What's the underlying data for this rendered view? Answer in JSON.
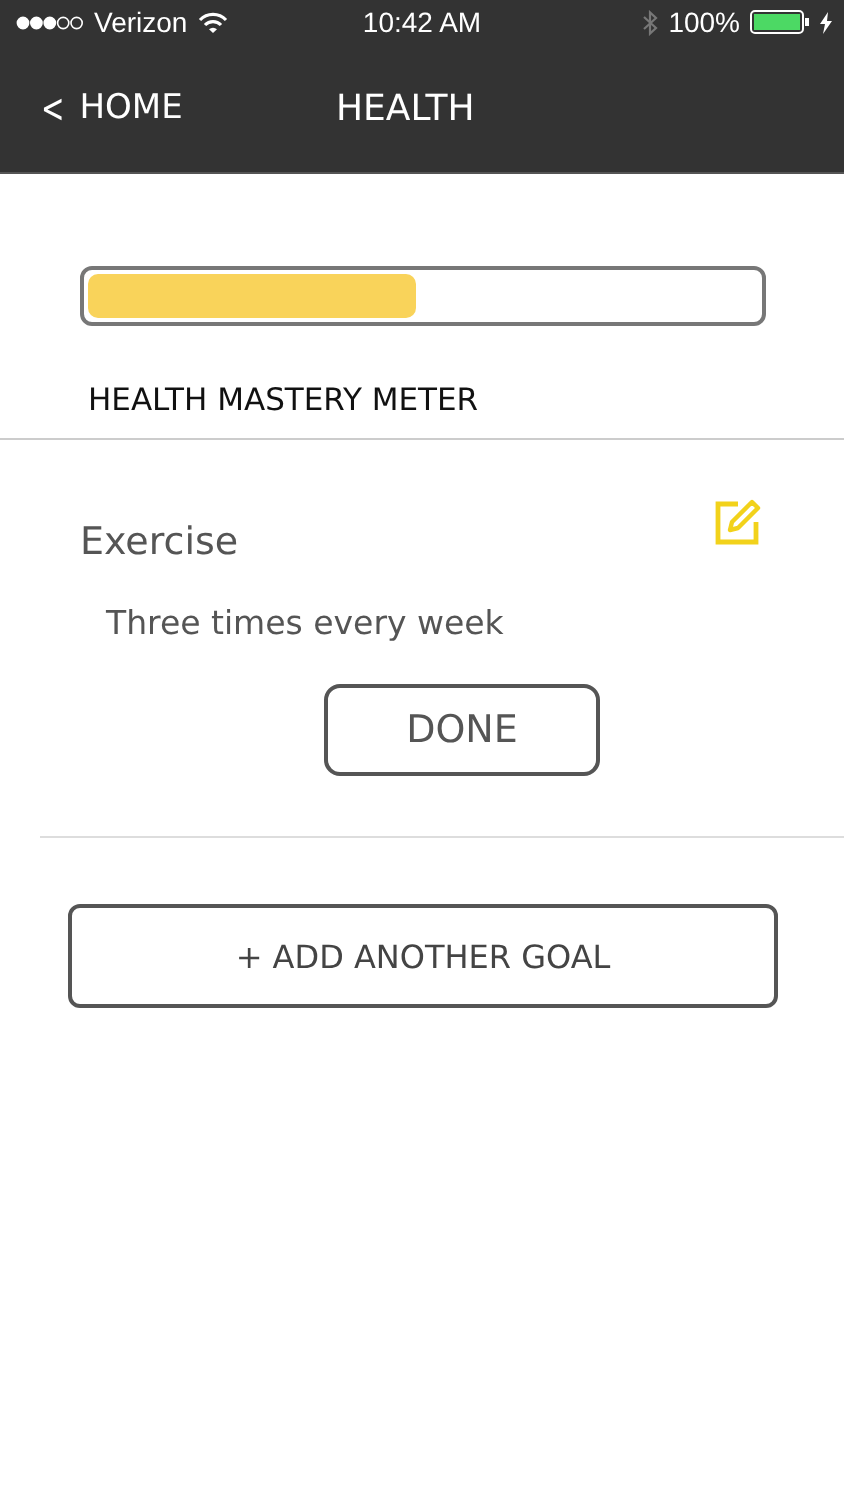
{
  "status_bar": {
    "carrier": "Verizon",
    "time": "10:42 AM",
    "battery": "100%"
  },
  "nav": {
    "back": "HOME",
    "back_icon": "<",
    "title": "HEALTH"
  },
  "meter": {
    "level": 0.49,
    "label": "HEALTH MASTERY METER"
  },
  "goals": [
    {
      "title": "Exercise",
      "description": "Three times every week",
      "action": "DONE"
    }
  ],
  "add_button": "+ ADD ANOTHER GOAL"
}
